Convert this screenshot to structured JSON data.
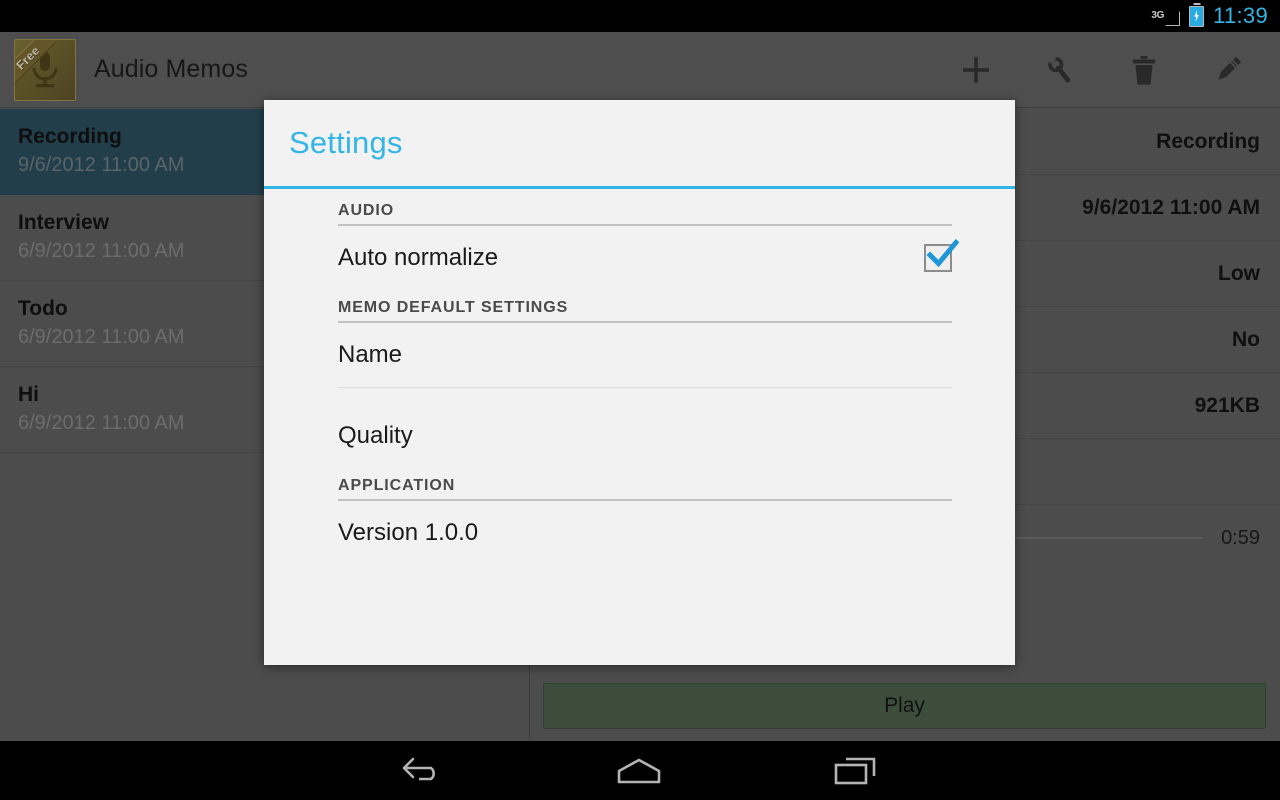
{
  "status_bar": {
    "network_label": "3G",
    "network_icon": "signal-triangle-icon",
    "battery_icon": "battery-charging-icon",
    "clock": "11:39"
  },
  "action_bar": {
    "app_icon": "microphone-app-icon",
    "icon_ribbon_label": "Free",
    "title": "Audio Memos",
    "actions": [
      {
        "name": "add-button",
        "icon": "plus-icon",
        "label": "Add"
      },
      {
        "name": "tools-button",
        "icon": "wrench-icon",
        "label": "Tools"
      },
      {
        "name": "delete-button",
        "icon": "trash-icon",
        "label": "Delete"
      },
      {
        "name": "edit-button",
        "icon": "pencil-icon",
        "label": "Edit"
      }
    ]
  },
  "memo_list": {
    "items": [
      {
        "title": "Recording",
        "date": "9/6/2012 11:00 AM",
        "selected": true
      },
      {
        "title": "Interview",
        "date": "6/9/2012 11:00 AM",
        "selected": false
      },
      {
        "title": "Todo",
        "date": "6/9/2012 11:00 AM",
        "selected": false
      },
      {
        "title": "Hi",
        "date": "6/9/2012 11:00 AM",
        "selected": false
      }
    ]
  },
  "detail_pane": {
    "rows": [
      {
        "label": "",
        "value": "Recording"
      },
      {
        "label": "",
        "value": "9/6/2012 11:00 AM"
      },
      {
        "label": "",
        "value": "Low"
      },
      {
        "label": "",
        "value": "No"
      },
      {
        "label": "",
        "value": "921KB"
      }
    ],
    "seek_time": "0:59",
    "play_label": "Play"
  },
  "dialog": {
    "title": "Settings",
    "accent_color": "#33b5e5",
    "sections": [
      {
        "header": "AUDIO",
        "rows": [
          {
            "label": "Auto normalize",
            "type": "checkbox",
            "checked": true
          }
        ]
      },
      {
        "header": "MEMO DEFAULT SETTINGS",
        "rows": [
          {
            "label": "Name",
            "type": "text",
            "checked": false
          },
          {
            "label": "Quality",
            "type": "text",
            "checked": false
          }
        ]
      },
      {
        "header": "APPLICATION",
        "rows": [
          {
            "label": "Version 1.0.0",
            "type": "text",
            "checked": false
          }
        ]
      }
    ]
  },
  "nav_bar": {
    "back_label": "Back",
    "home_label": "Home",
    "recents_label": "Recent apps"
  },
  "colors": {
    "accent": "#33b5e5",
    "selected_row": "#2b4c5c",
    "chrome": "#5d5d5d",
    "dialog_bg": "#f2f2f2",
    "play_button": "#4a5f4a"
  }
}
